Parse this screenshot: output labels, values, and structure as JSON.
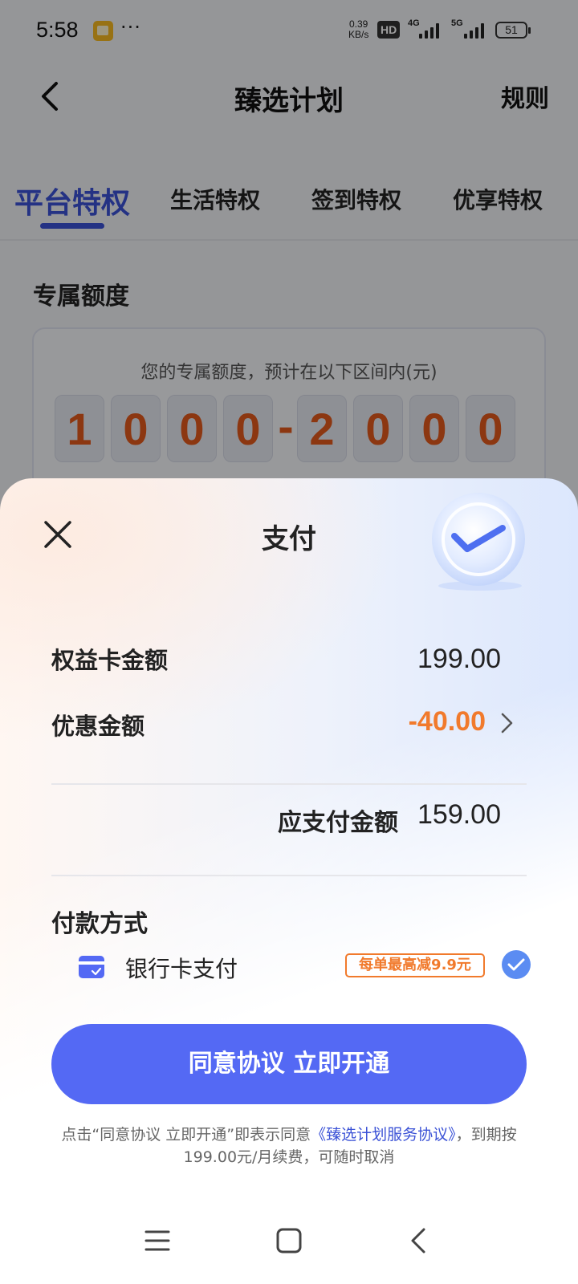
{
  "status_bar": {
    "time": "5:58",
    "more": "···",
    "net_speed_value": "0.39",
    "net_speed_unit": "KB/s",
    "hd": "HD",
    "sig1": "4G",
    "sig2": "5G",
    "battery": "51"
  },
  "nav": {
    "title": "臻选计划",
    "rules": "规则"
  },
  "tabs": [
    {
      "label": "平台特权",
      "active": true
    },
    {
      "label": "生活特权"
    },
    {
      "label": "签到特权"
    },
    {
      "label": "优享特权"
    }
  ],
  "quota": {
    "section_title": "专属额度",
    "description": "您的专属额度，预计在以下区间内(元)",
    "digits": [
      "1",
      "0",
      "0",
      "0",
      "-",
      "2",
      "0",
      "0",
      "0"
    ]
  },
  "sheet": {
    "title": "支付",
    "card_amount_label": "权益卡金额",
    "card_amount_value": "199.00",
    "discount_label": "优惠金额",
    "discount_value": "-40.00",
    "payable_label": "应支付金额",
    "payable_value": "159.00",
    "payment_method_title": "付款方式",
    "payment_option_label": "银行卡支付",
    "promo_badge": "每单最高减9.9元",
    "cta_label": "同意协议 立即开通",
    "agreement_prefix": "点击“同意协议 立即开通”即表示同意",
    "agreement_link": "《臻选计划服务协议》",
    "agreement_suffix": "，到期按199.00元/月续费，可随时取消"
  },
  "colors": {
    "accent": "#5469f4",
    "tab_active": "#3b52d6",
    "discount": "#f17a2c",
    "quota_digit": "#e25a1c"
  },
  "icons": [
    "back-icon",
    "close-icon",
    "badge-check-icon",
    "chevron-right-icon",
    "bank-card-icon",
    "check-circle-icon",
    "menu-icon",
    "home-icon",
    "nav-back-icon"
  ]
}
